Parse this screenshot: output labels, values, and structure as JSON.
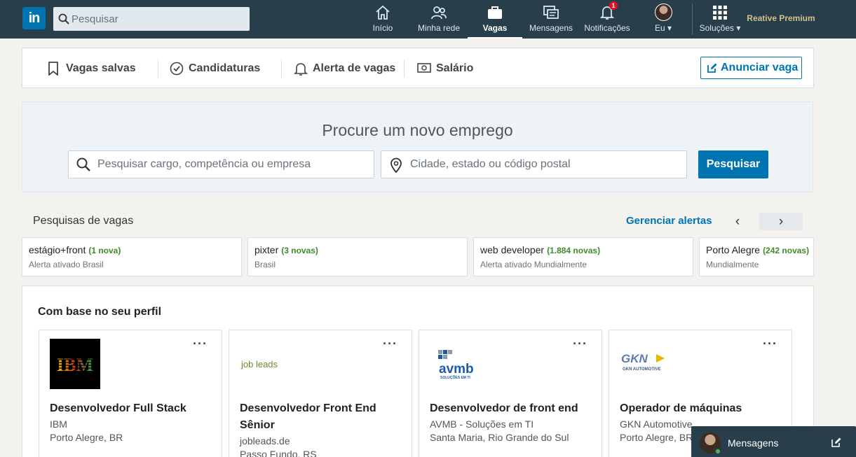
{
  "nav": {
    "logo": "in",
    "search_placeholder": "Pesquisar",
    "items": [
      {
        "label": "Início"
      },
      {
        "label": "Minha rede"
      },
      {
        "label": "Vagas"
      },
      {
        "label": "Mensagens"
      },
      {
        "label": "Notificações",
        "badge": "1"
      },
      {
        "label": "Eu ▾"
      },
      {
        "label": "Soluções ▾"
      }
    ],
    "premium": "Reative Premium"
  },
  "subnav": {
    "saved_jobs": "Vagas salvas",
    "applications": "Candidaturas",
    "job_alerts": "Alerta de vagas",
    "salary": "Salário",
    "post_job": "Anunciar vaga"
  },
  "hero": {
    "title": "Procure um novo emprego",
    "keyword_placeholder": "Pesquisar cargo, competência ou empresa",
    "location_placeholder": "Cidade, estado ou código postal",
    "search_button": "Pesquisar"
  },
  "saved_searches": {
    "title": "Pesquisas de vagas",
    "manage": "Gerenciar alertas",
    "prev": "‹",
    "next": "›",
    "cards": [
      {
        "query": "estágio+front",
        "new": "(1 nova)",
        "sub": "Alerta ativado Brasil"
      },
      {
        "query": "pixter",
        "new": "(3 novas)",
        "sub": "Brasil"
      },
      {
        "query": "web developer",
        "new": "(1.884 novas)",
        "sub": "Alerta ativado Mundialmente"
      },
      {
        "query": "Porto Alegre",
        "new": "(242 novas)",
        "sub": "Mundialmente"
      }
    ]
  },
  "recommended": {
    "title": "Com base no seu perfil",
    "jobs": [
      {
        "logo_text": "IBM",
        "title": "Desenvolvedor Full Stack",
        "company": "IBM",
        "location": "Porto Alegre, BR"
      },
      {
        "logo_text": "job leads",
        "title": "Desenvolvedor Front End Sênior",
        "company": "jobleads.de",
        "location": "Passo Fundo, RS"
      },
      {
        "logo_text": "avmb",
        "logo_sub": "SOLUÇÕES EM TI",
        "title": "Desenvolvedor de front end",
        "company": "AVMB - Soluções em TI",
        "location": "Santa Maria, Rio Grande do Sul"
      },
      {
        "logo_text": "GKN",
        "logo_sub": "GKN AUTOMOTIVE",
        "title": "Operador de máquinas",
        "company": "GKN Automotive",
        "location": "Porto Alegre, BR"
      }
    ]
  },
  "messaging": {
    "label": "Mensagens"
  },
  "colors": {
    "nav_bg": "#283e4a",
    "accent": "#0073b1",
    "new_count": "#3f8a2b",
    "premium": "#d4c28a"
  }
}
